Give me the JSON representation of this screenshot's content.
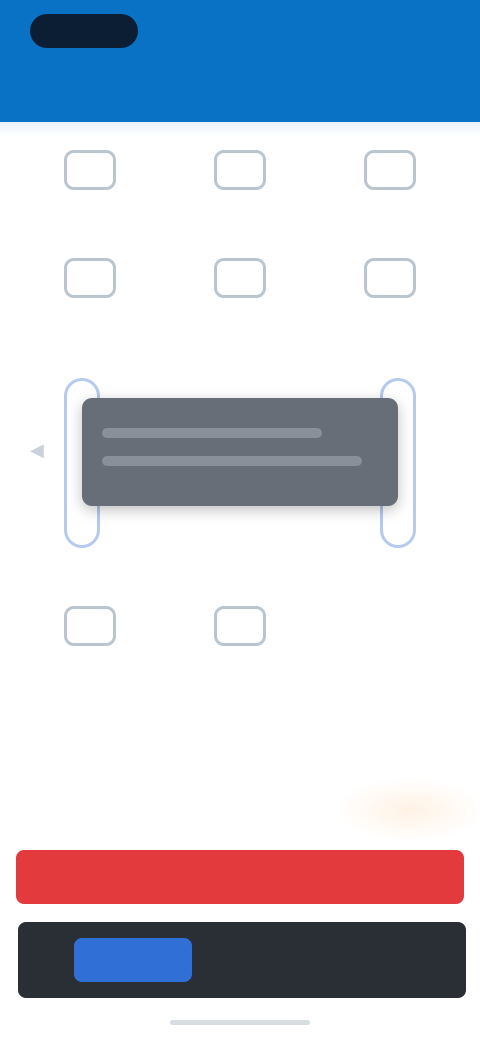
{
  "status_bar": {
    "pill": "",
    "right": ""
  },
  "header": {
    "title": ""
  },
  "grid": {
    "tiles": [
      {
        "label": "",
        "icon": "app-icon"
      },
      {
        "label": "",
        "icon": "app-icon"
      },
      {
        "label": "",
        "icon": "app-icon"
      },
      {
        "label": "",
        "icon": "app-icon"
      },
      {
        "label": "",
        "icon": "app-icon"
      },
      {
        "label": "",
        "icon": "app-icon"
      },
      {
        "label": "",
        "icon": "app-icon"
      },
      {
        "label": "",
        "icon": "app-icon"
      },
      {
        "label": "",
        "icon": "app-icon"
      },
      {
        "label": "",
        "icon": "app-icon"
      },
      {
        "label": "",
        "icon": "app-icon"
      }
    ]
  },
  "dragged_item": {
    "label": ""
  },
  "notice": {
    "title": "",
    "subtitle": ""
  },
  "red_banner": {
    "text": ""
  },
  "bottom_bar": {
    "button_label": "",
    "text": ""
  },
  "colors": {
    "header": "#0a72c4",
    "banner": "#e33a3e",
    "button": "#2f6fd6",
    "bar": "#2a2f36"
  }
}
